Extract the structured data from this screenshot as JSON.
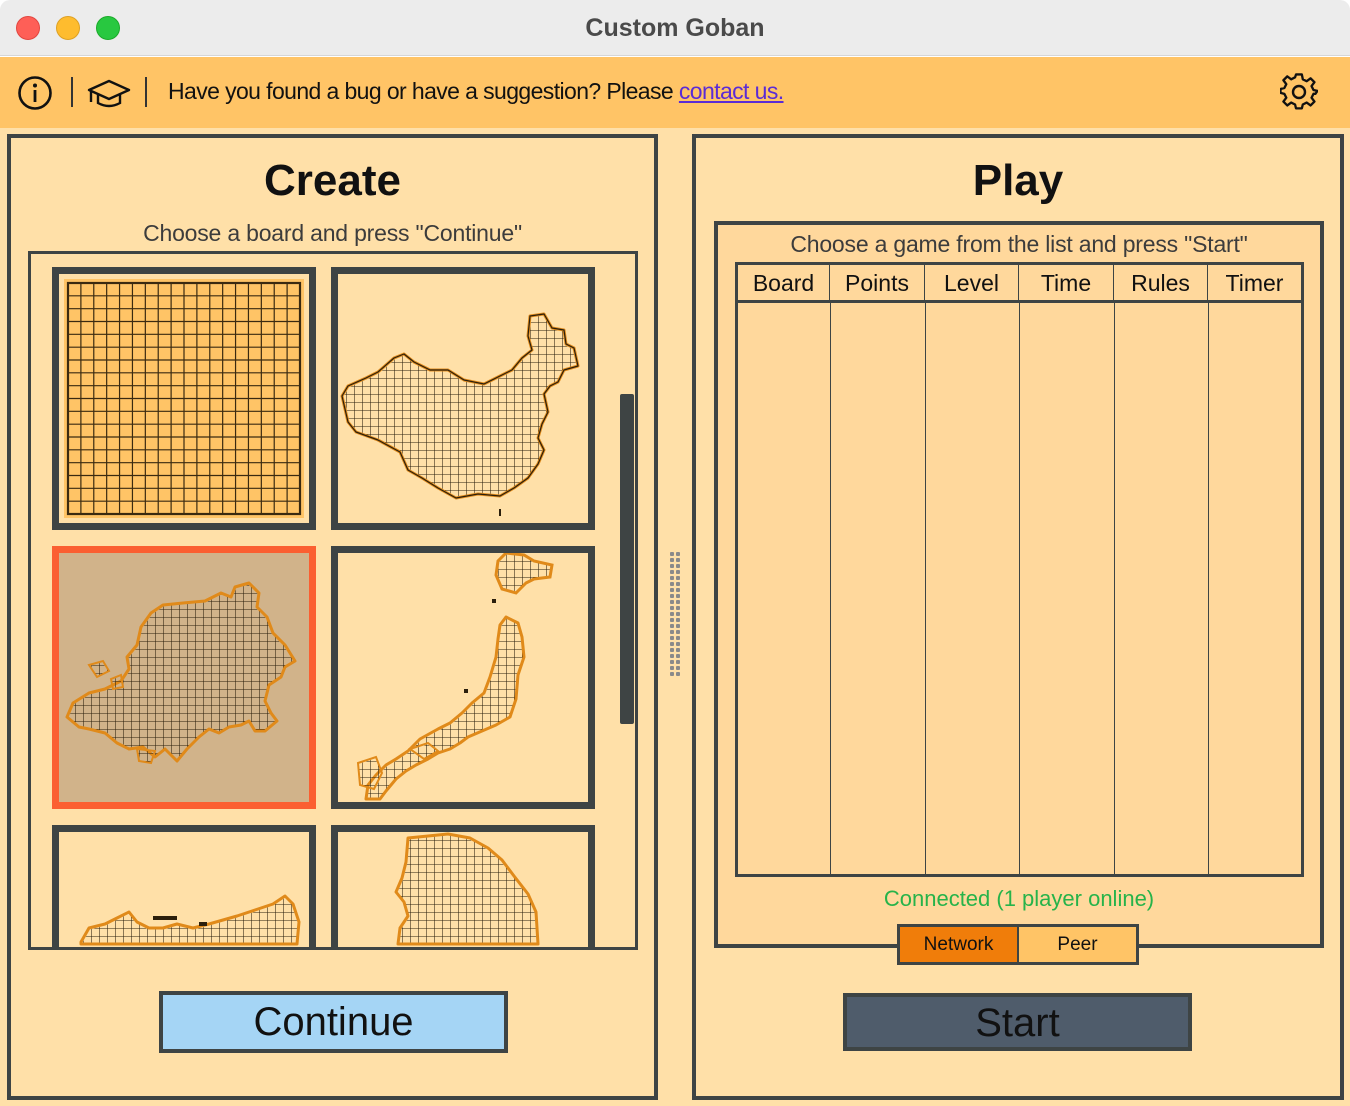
{
  "window": {
    "title": "Custom Goban"
  },
  "infobar": {
    "message": "Have you found a bug or have a suggestion? Please ",
    "link": "contact us.",
    "icons": [
      "info-icon",
      "graduation-cap-icon",
      "gear-icon"
    ]
  },
  "create": {
    "title": "Create",
    "instruction": "Choose a board and press \"Continue\"",
    "boards": [
      {
        "shape": "square-grid",
        "selected": false
      },
      {
        "shape": "china-map",
        "selected": false
      },
      {
        "shape": "europe-map",
        "selected": true
      },
      {
        "shape": "japan-map",
        "selected": false
      },
      {
        "shape": "russia-map",
        "selected": false
      },
      {
        "shape": "korea-map",
        "selected": false
      }
    ],
    "continue_label": "Continue"
  },
  "play": {
    "title": "Play",
    "instruction": "Choose a game from the list and press \"Start\"",
    "columns": [
      "Board",
      "Points",
      "Level",
      "Time",
      "Rules",
      "Timer"
    ],
    "rows": [],
    "status": "Connected (1 player online)",
    "modes": [
      "Network",
      "Peer"
    ],
    "active_mode": "Network",
    "start_label": "Start"
  },
  "colors": {
    "panel_bg": "#ffe0a8",
    "infobar_bg": "#ffc466",
    "border": "#3e4444",
    "selected_border": "#fb5f31",
    "continue_bg": "#a5d5f5",
    "start_bg": "#4f5c6b",
    "network_active": "#f07d0a",
    "status_green": "#27b34a",
    "link": "#5b2bd6"
  }
}
